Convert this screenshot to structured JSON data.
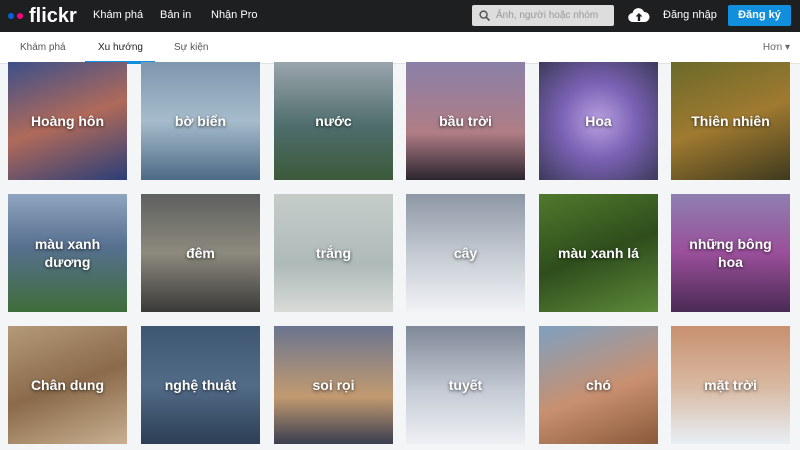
{
  "header": {
    "logo": "flickr",
    "nav": [
      "Khám phá",
      "Bản in",
      "Nhận Pro"
    ],
    "search_placeholder": "Ảnh, người hoặc nhóm",
    "login": "Đăng nhập",
    "signup": "Đăng ký",
    "colors": {
      "blue_dot": "#0063dc",
      "pink_dot": "#ff0084",
      "signup": "#128fdc"
    }
  },
  "subnav": {
    "tabs": [
      "Khám phá",
      "Xu hướng",
      "Sự kiện"
    ],
    "active": "Xu hướng",
    "more": "Hơn ▾"
  },
  "tiles": [
    {
      "label": "Hoàng hôn",
      "bg": "linear-gradient(160deg,#3c4f8a,#b06a5a 50%,#2b3e78)"
    },
    {
      "label": "bờ biển",
      "bg": "linear-gradient(180deg,#7d97ae,#a6bccc 50%,#4d6a85)"
    },
    {
      "label": "nước",
      "bg": "linear-gradient(180deg,#9aa5ad,#4e6d6c 55%,#3c5a3a)"
    },
    {
      "label": "bầu trời",
      "bg": "linear-gradient(180deg,#8a80a8,#b07d85 60%,#2b2530)"
    },
    {
      "label": "Hoa",
      "bg": "radial-gradient(circle at 50% 50%,#b9a0e0,#7b62b5 45%,#3d3a5a)"
    },
    {
      "label": "Thiên nhiên",
      "bg": "linear-gradient(160deg,#6a6a2a,#a07a30 50%,#3e3a1e)"
    },
    {
      "label": "màu xanh dương",
      "bg": "linear-gradient(180deg,#8fa5c0,#56708f 45%,#3f6d3a)"
    },
    {
      "label": "đêm",
      "bg": "linear-gradient(180deg,#5e6060,#8d8a7e 50%,#3a3a38)"
    },
    {
      "label": "trắng",
      "bg": "linear-gradient(180deg,#c5ccc9,#aebab8 60%,#d8dbd8)"
    },
    {
      "label": "cây",
      "bg": "linear-gradient(180deg,#8d97a5,#c9ced6 55%,#f0f2f5)"
    },
    {
      "label": "màu xanh lá",
      "bg": "linear-gradient(160deg,#4f7a2c,#2e4d1c 50%,#5d8a3a)"
    },
    {
      "label": "những bông hoa",
      "bg": "linear-gradient(180deg,#8e7fb0,#9a4f9a 50%,#4a2a55)"
    },
    {
      "label": "Chân dung",
      "bg": "linear-gradient(160deg,#b49a7a,#8a6a4a 50%,#c8b090)"
    },
    {
      "label": "nghệ thuật",
      "bg": "linear-gradient(180deg,#3e5672,#526c88 50%,#2c3e55)"
    },
    {
      "label": "soi rọi",
      "bg": "linear-gradient(180deg,#6a7590,#c29a70 60%,#3a3e50)"
    },
    {
      "label": "tuyết",
      "bg": "linear-gradient(180deg,#7f8898,#c5cbd5 55%,#eef0f4)"
    },
    {
      "label": "chó",
      "bg": "linear-gradient(160deg,#7ea0c0,#c89070 55%,#8a5a3a)"
    },
    {
      "label": "mặt trời",
      "bg": "linear-gradient(180deg,#c89070,#d8b8a0 50%,#e8eef5)"
    }
  ]
}
